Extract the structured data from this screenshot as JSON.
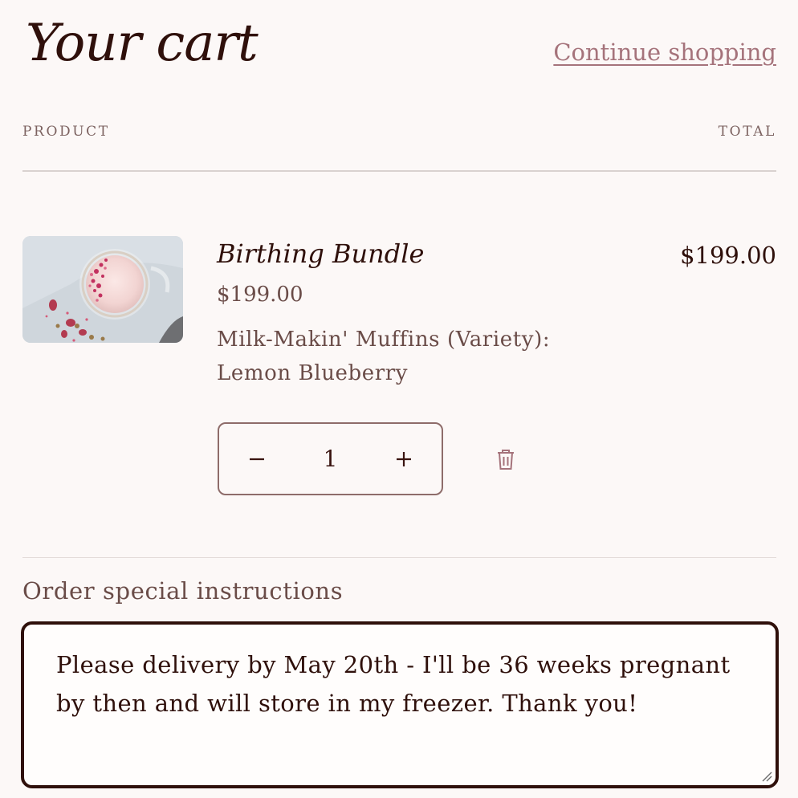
{
  "header": {
    "title": "Your cart",
    "continue_link": "Continue shopping"
  },
  "columns": {
    "product": "PRODUCT",
    "total": "TOTAL"
  },
  "cart_items": [
    {
      "name": "Birthing Bundle",
      "unit_price": "$199.00",
      "variant_name": "Milk-Makin' Muffins (Variety):",
      "variant_value": "Lemon Blueberry",
      "quantity": "1",
      "line_total": "$199.00",
      "image_icon": "product-photo-latte-with-rose-petals"
    }
  ],
  "quantity_controls": {
    "decrease_icon": "minus-icon",
    "increase_icon": "plus-icon",
    "remove_icon": "trash-icon"
  },
  "instructions": {
    "label": "Order special instructions",
    "value": "Please delivery by May 20th - I'll be 36 weeks pregnant by then and will store in my freezer. Thank you!"
  },
  "colors": {
    "background": "#fcf8f7",
    "text_dark": "#2f100b",
    "text_muted": "#6a4c48",
    "link_accent": "#a5737b",
    "border": "#8e6c6a"
  }
}
